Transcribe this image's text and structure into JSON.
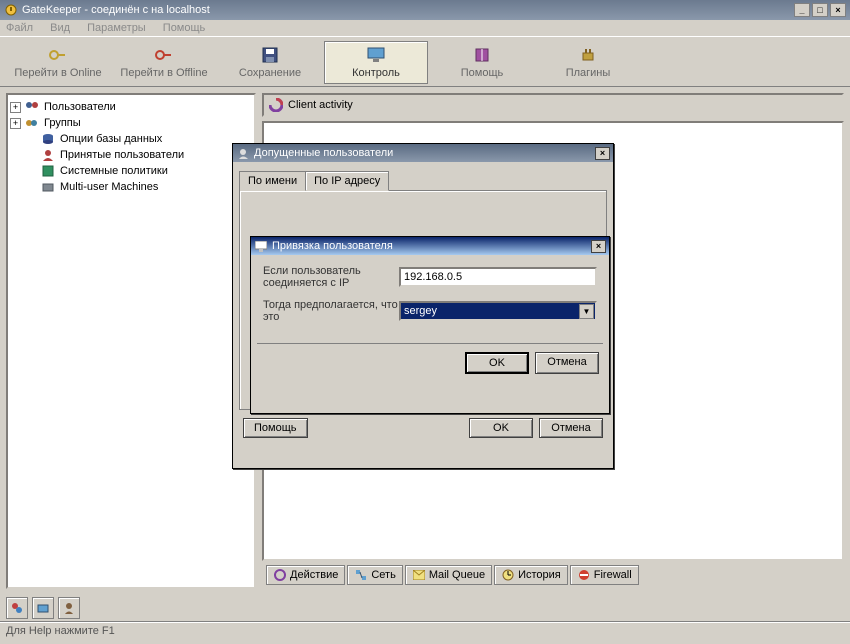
{
  "window": {
    "title": "GateKeeper - соединён с на localhost"
  },
  "menu": {
    "file": "Файл",
    "view": "Вид",
    "params": "Параметры",
    "help": "Помощь"
  },
  "toolbar": {
    "online": "Перейти в Online",
    "offline": "Перейти в Offline",
    "save": "Сохранение",
    "control": "Контроль",
    "help": "Помощь",
    "plugins": "Плагины"
  },
  "tree": {
    "users": "Пользователи",
    "groups": "Группы",
    "dbopts": "Опции базы данных",
    "accepted": "Принятые пользователи",
    "syspol": "Системные политики",
    "multi": "Multi-user Machines"
  },
  "panel_caption": "Client activity",
  "bottom_tabs": {
    "action": "Действие",
    "net": "Сеть",
    "mail": "Mail Queue",
    "history": "История",
    "firewall": "Firewall"
  },
  "statusbar": "Для Help нажмите F1",
  "dlg1": {
    "title": "Допущенные пользователи",
    "tab_name": "По имени",
    "tab_ip": "По IP адресу",
    "help": "Помощь",
    "ok": "OK",
    "cancel": "Отмена"
  },
  "dlg2": {
    "title": "Привязка пользователя",
    "lbl_ip": "Если пользователь соединяется с IP",
    "val_ip": "192.168.0.5",
    "lbl_user": "Тогда предполагается, что это",
    "val_user": "sergey",
    "ok": "OK",
    "cancel": "Отмена"
  }
}
